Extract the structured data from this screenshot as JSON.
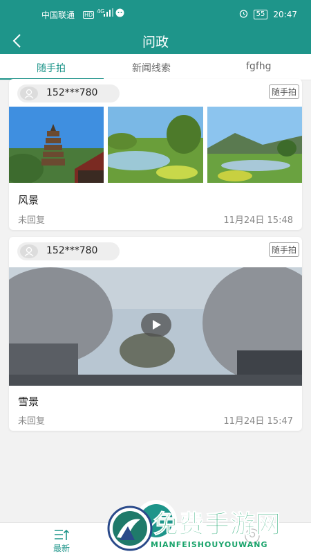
{
  "status_bar": {
    "carrier": "中国联通",
    "network_badge": "HD",
    "network_type": "4G",
    "battery": "55",
    "time": "20:47"
  },
  "header": {
    "title": "问政"
  },
  "tabs": [
    {
      "label": "随手拍",
      "active": true
    },
    {
      "label": "新闻线索",
      "active": false
    },
    {
      "label": "fgfhg",
      "active": false
    }
  ],
  "posts": [
    {
      "user": "152***780",
      "tag": "随手拍",
      "title": "风景",
      "status": "未回复",
      "time": "11月24日 15:48",
      "media": "images"
    },
    {
      "user": "152***780",
      "tag": "随手拍",
      "title": "雪景",
      "status": "未回复",
      "time": "11月24日 15:47",
      "media": "video"
    }
  ],
  "bottom_nav": {
    "latest_label": "最新"
  },
  "watermark": {
    "title": "免费手游网",
    "subtitle": "MIANFEISHOUYOUWANG"
  },
  "colors": {
    "primary": "#1e958a",
    "watermark": "#19a36b"
  }
}
